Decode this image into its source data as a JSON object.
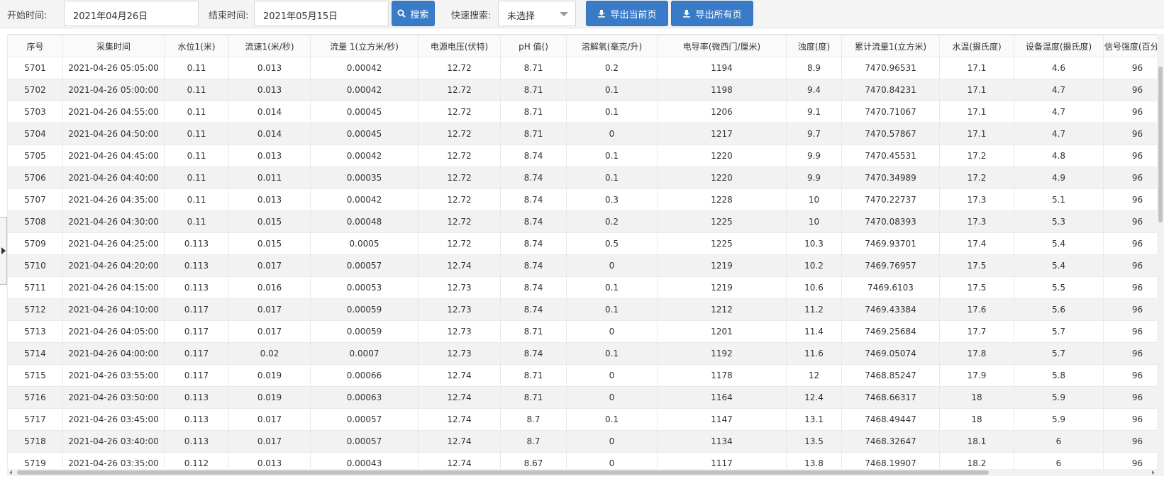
{
  "toolbar": {
    "start_label": "开始时间:",
    "start_value": "2021年04月26日",
    "end_label": "结束时间:",
    "end_value": "2021年05月15日",
    "search_label": "搜索",
    "quick_label": "快速搜索:",
    "quick_value": "未选择",
    "export_current_label": "导出当前页",
    "export_all_label": "导出所有页"
  },
  "colors": {
    "accent": "#3a7bc8",
    "row_alt": "#f2f2f2"
  },
  "table": {
    "headers": [
      "序号",
      "采集时间",
      "水位1(米)",
      "流速1(米/秒)",
      "流量 1(立方米/秒)",
      "电源电压(伏特)",
      "pH 值()",
      "溶解氧(毫克/升)",
      "电导率(微西门/厘米)",
      "浊度(度)",
      "累计流量1(立方米)",
      "水温(摄氏度)",
      "设备温度(摄氏度)",
      "信号强度(百分比)"
    ],
    "rows": [
      [
        "5701",
        "2021-04-26 05:05:00",
        "0.11",
        "0.013",
        "0.00042",
        "12.72",
        "8.71",
        "0.2",
        "1194",
        "8.9",
        "7470.96531",
        "17.1",
        "4.6",
        "96"
      ],
      [
        "5702",
        "2021-04-26 05:00:00",
        "0.11",
        "0.013",
        "0.00042",
        "12.72",
        "8.71",
        "0.1",
        "1198",
        "9.4",
        "7470.84231",
        "17.1",
        "4.7",
        "96"
      ],
      [
        "5703",
        "2021-04-26 04:55:00",
        "0.11",
        "0.014",
        "0.00045",
        "12.72",
        "8.71",
        "0.1",
        "1206",
        "9.1",
        "7470.71067",
        "17.1",
        "4.7",
        "96"
      ],
      [
        "5704",
        "2021-04-26 04:50:00",
        "0.11",
        "0.014",
        "0.00045",
        "12.72",
        "8.71",
        "0",
        "1217",
        "9.7",
        "7470.57867",
        "17.1",
        "4.7",
        "96"
      ],
      [
        "5705",
        "2021-04-26 04:45:00",
        "0.11",
        "0.013",
        "0.00042",
        "12.72",
        "8.74",
        "0.1",
        "1220",
        "9.9",
        "7470.45531",
        "17.2",
        "4.8",
        "96"
      ],
      [
        "5706",
        "2021-04-26 04:40:00",
        "0.11",
        "0.011",
        "0.00035",
        "12.72",
        "8.74",
        "0.1",
        "1220",
        "9.9",
        "7470.34989",
        "17.2",
        "4.9",
        "96"
      ],
      [
        "5707",
        "2021-04-26 04:35:00",
        "0.11",
        "0.013",
        "0.00042",
        "12.72",
        "8.74",
        "0.3",
        "1228",
        "10",
        "7470.22737",
        "17.3",
        "5.1",
        "96"
      ],
      [
        "5708",
        "2021-04-26 04:30:00",
        "0.11",
        "0.015",
        "0.00048",
        "12.72",
        "8.74",
        "0.2",
        "1225",
        "10",
        "7470.08393",
        "17.3",
        "5.3",
        "96"
      ],
      [
        "5709",
        "2021-04-26 04:25:00",
        "0.113",
        "0.015",
        "0.0005",
        "12.72",
        "8.74",
        "0.5",
        "1225",
        "10.3",
        "7469.93701",
        "17.4",
        "5.4",
        "96"
      ],
      [
        "5710",
        "2021-04-26 04:20:00",
        "0.113",
        "0.017",
        "0.00057",
        "12.74",
        "8.74",
        "0",
        "1219",
        "10.2",
        "7469.76957",
        "17.5",
        "5.4",
        "96"
      ],
      [
        "5711",
        "2021-04-26 04:15:00",
        "0.113",
        "0.016",
        "0.00053",
        "12.73",
        "8.74",
        "0.1",
        "1219",
        "10.6",
        "7469.6103",
        "17.5",
        "5.5",
        "96"
      ],
      [
        "5712",
        "2021-04-26 04:10:00",
        "0.117",
        "0.017",
        "0.00059",
        "12.73",
        "8.74",
        "0.1",
        "1212",
        "11.2",
        "7469.43384",
        "17.6",
        "5.6",
        "96"
      ],
      [
        "5713",
        "2021-04-26 04:05:00",
        "0.117",
        "0.017",
        "0.00059",
        "12.73",
        "8.71",
        "0",
        "1201",
        "11.4",
        "7469.25684",
        "17.7",
        "5.7",
        "96"
      ],
      [
        "5714",
        "2021-04-26 04:00:00",
        "0.117",
        "0.02",
        "0.0007",
        "12.73",
        "8.74",
        "0.1",
        "1192",
        "11.6",
        "7469.05074",
        "17.8",
        "5.7",
        "96"
      ],
      [
        "5715",
        "2021-04-26 03:55:00",
        "0.117",
        "0.019",
        "0.00066",
        "12.74",
        "8.71",
        "0",
        "1178",
        "12",
        "7468.85247",
        "17.9",
        "5.8",
        "96"
      ],
      [
        "5716",
        "2021-04-26 03:50:00",
        "0.113",
        "0.019",
        "0.00063",
        "12.74",
        "8.71",
        "0",
        "1164",
        "12.4",
        "7468.66317",
        "18",
        "5.9",
        "96"
      ],
      [
        "5717",
        "2021-04-26 03:45:00",
        "0.113",
        "0.017",
        "0.00057",
        "12.74",
        "8.7",
        "0.1",
        "1147",
        "13.1",
        "7468.49447",
        "18",
        "5.9",
        "96"
      ],
      [
        "5718",
        "2021-04-26 03:40:00",
        "0.113",
        "0.017",
        "0.00057",
        "12.74",
        "8.7",
        "0",
        "1134",
        "13.5",
        "7468.32647",
        "18.1",
        "6",
        "96"
      ],
      [
        "5719",
        "2021-04-26 03:35:00",
        "0.112",
        "0.013",
        "0.00043",
        "12.74",
        "8.67",
        "0",
        "1117",
        "13.8",
        "7468.19907",
        "18.2",
        "6",
        "96"
      ]
    ]
  }
}
